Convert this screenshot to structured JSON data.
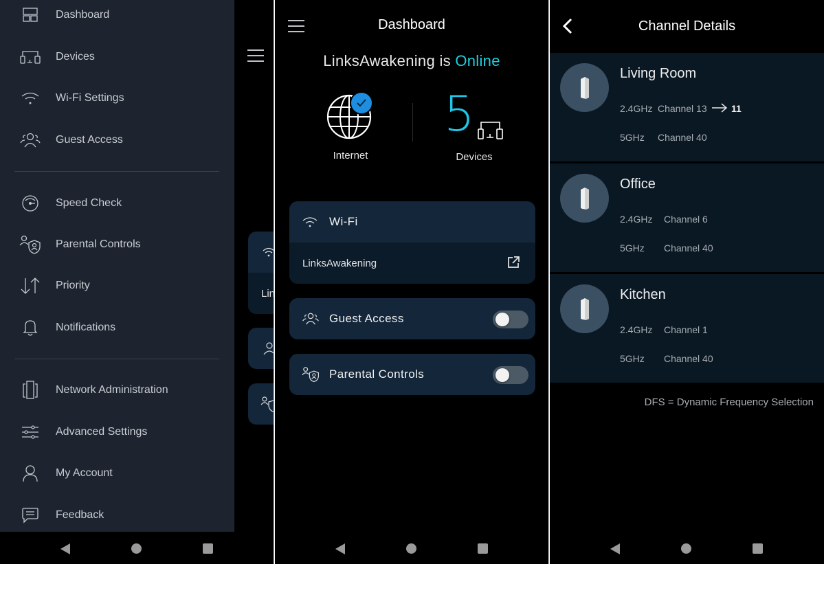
{
  "drawer": {
    "items": [
      {
        "label": "Dashboard",
        "icon": "dashboard-icon"
      },
      {
        "label": "Devices",
        "icon": "devices-icon"
      },
      {
        "label": "Wi-Fi Settings",
        "icon": "wifi-icon"
      },
      {
        "label": "Guest Access",
        "icon": "guest-access-icon"
      },
      {
        "label": "Speed Check",
        "icon": "speedometer-icon"
      },
      {
        "label": "Parental Controls",
        "icon": "parental-controls-icon"
      },
      {
        "label": "Priority",
        "icon": "priority-arrows-icon"
      },
      {
        "label": "Notifications",
        "icon": "bell-icon"
      },
      {
        "label": "Network Administration",
        "icon": "network-admin-icon"
      },
      {
        "label": "Advanced Settings",
        "icon": "sliders-icon"
      },
      {
        "label": "My Account",
        "icon": "user-icon"
      },
      {
        "label": "Feedback",
        "icon": "chat-bubble-icon"
      }
    ],
    "behind_text": "Lin"
  },
  "dashboard": {
    "title": "Dashboard",
    "network_name": "LinksAwakening",
    "status_connector": "is",
    "status": "Online",
    "internet_label": "Internet",
    "device_count": "5",
    "devices_label": "Devices",
    "wifi_card": {
      "title": "Wi-Fi",
      "network": "LinksAwakening"
    },
    "guest_access": {
      "label": "Guest Access",
      "enabled": false
    },
    "parental_controls": {
      "label": "Parental Controls",
      "enabled": false
    }
  },
  "channel_details": {
    "title": "Channel Details",
    "nodes": [
      {
        "name": "Living Room",
        "band24": "2.4GHz",
        "ch24": "Channel 13",
        "ch24_new": "11",
        "band5": "5GHz",
        "ch5": "Channel 40"
      },
      {
        "name": "Office",
        "band24": "2.4GHz",
        "ch24": "Channel 6",
        "band5": "5GHz",
        "ch5": "Channel 40"
      },
      {
        "name": "Kitchen",
        "band24": "2.4GHz",
        "ch24": "Channel 1",
        "band5": "5GHz",
        "ch5": "Channel 40"
      }
    ],
    "footnote": "DFS = Dynamic Frequency Selection"
  },
  "colors": {
    "accent_online": "#1fd0e0",
    "card_bg": "#13263a",
    "drawer_bg": "#1d2430",
    "node_bg": "#0a1824"
  }
}
